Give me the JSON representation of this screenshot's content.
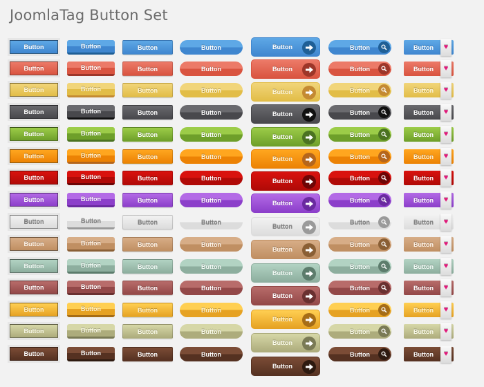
{
  "title": "JoomlaTag Button Set",
  "button_label": "Button",
  "colors": [
    {
      "name": "blue",
      "top": "#5ea8e6",
      "bot": "#3f86cf",
      "dark": "#1f5f96",
      "text": "#ffffff"
    },
    {
      "name": "red",
      "top": "#ec7a68",
      "bot": "#d95440",
      "dark": "#9d3629",
      "text": "#ffffff"
    },
    {
      "name": "yellow",
      "top": "#f1d57a",
      "bot": "#e2bd47",
      "dark": "#c48a32",
      "text": "#fff6d8"
    },
    {
      "name": "charcoal",
      "top": "#6a6a6e",
      "bot": "#48484c",
      "dark": "#111111",
      "text": "#ffffff"
    },
    {
      "name": "green",
      "top": "#9ccc48",
      "bot": "#6e9f2a",
      "dark": "#4b7321",
      "text": "#ffffff"
    },
    {
      "name": "orange",
      "top": "#ffa61f",
      "bot": "#ec8204",
      "dark": "#b5661c",
      "text": "#fff2d6"
    },
    {
      "name": "crimson",
      "top": "#d9120e",
      "bot": "#b00a07",
      "dark": "#6e0505",
      "text": "#ffffff"
    },
    {
      "name": "purple",
      "top": "#b36ae6",
      "bot": "#8c3fca",
      "dark": "#6a2aa0",
      "text": "#ffffff"
    },
    {
      "name": "silver",
      "top": "#f2f2f2",
      "bot": "#dcdcdc",
      "dark": "#9a9a9a",
      "text": "#808080"
    },
    {
      "name": "tan",
      "top": "#d7ad87",
      "bot": "#c08f62",
      "dark": "#8a5f35",
      "text": "#fff5ea"
    },
    {
      "name": "sage",
      "top": "#b2d3c3",
      "bot": "#8dae9e",
      "dark": "#5c7c6c",
      "text": "#f3fbf6"
    },
    {
      "name": "rosewood",
      "top": "#b86c6a",
      "bot": "#934848",
      "dark": "#6a3030",
      "text": "#ffffff"
    },
    {
      "name": "gold",
      "top": "#ffcf52",
      "bot": "#e6a223",
      "dark": "#a66d16",
      "text": "#fff3d0"
    },
    {
      "name": "olive",
      "top": "#d6d7a7",
      "bot": "#adac7c",
      "dark": "#7a7a55",
      "text": "#fbfbea"
    },
    {
      "name": "brown",
      "top": "#7b4c36",
      "bot": "#553121",
      "dark": "#2e1a10",
      "text": "#ffffff"
    }
  ],
  "columns": [
    {
      "id": "framed",
      "label": "Button"
    },
    {
      "id": "raised",
      "label": "Button"
    },
    {
      "id": "flat",
      "label": "Button"
    },
    {
      "id": "pill",
      "label": "Button"
    },
    {
      "id": "arrow",
      "label": "Button",
      "icon": "arrow-right-icon"
    },
    {
      "id": "search",
      "label": "Button",
      "icon": "search-icon"
    },
    {
      "id": "heart",
      "label": "Button",
      "icon": "heart-icon"
    }
  ]
}
